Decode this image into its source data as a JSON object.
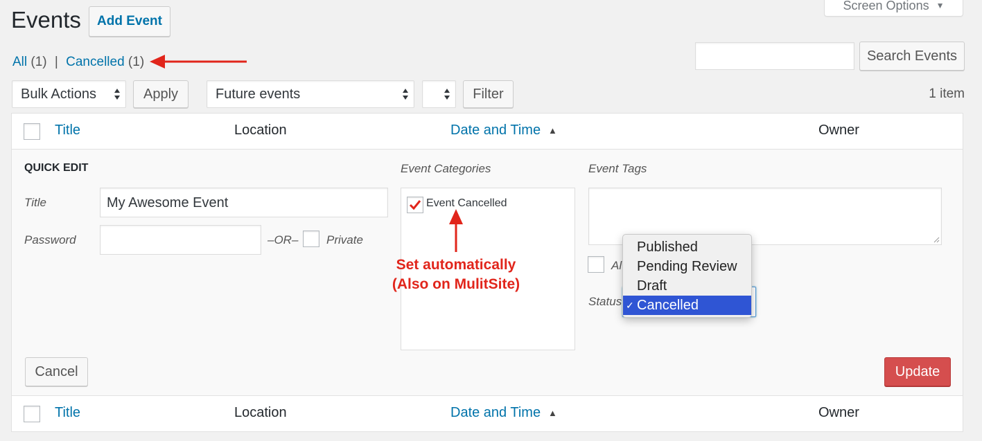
{
  "page": {
    "title": "Events",
    "add_button": "Add Event",
    "screen_options": "Screen Options"
  },
  "views": {
    "all_label": "All",
    "all_count": "(1)",
    "separator": "|",
    "cancelled_label": "Cancelled",
    "cancelled_count": "(1)"
  },
  "search": {
    "value": "",
    "button": "Search Events"
  },
  "toolbar": {
    "bulk_actions": "Bulk Actions",
    "apply": "Apply",
    "scope": "Future events",
    "category_select": "",
    "filter": "Filter",
    "item_count": "1 item"
  },
  "table": {
    "columns": [
      "Title",
      "Location",
      "Date and Time",
      "Owner"
    ]
  },
  "quick_edit": {
    "heading": "QUICK EDIT",
    "title_label": "Title",
    "title_value": "My Awesome Event",
    "password_label": "Password",
    "password_value": "",
    "or_label": "–OR–",
    "private_label": "Private",
    "categories_label": "Event Categories",
    "categories": [
      {
        "label": "Event Cancelled",
        "checked": true
      }
    ],
    "tags_label": "Event Tags",
    "tags_value": "",
    "allow_comments_label": "Al",
    "status_label": "Status",
    "status_options": [
      "Published",
      "Pending Review",
      "Draft",
      "Cancelled"
    ],
    "status_selected": "Cancelled",
    "cancel": "Cancel",
    "update": "Update"
  },
  "annotation": {
    "line1": "Set automatically",
    "line2": "(Also on MulitSite)"
  },
  "colors": {
    "link": "#0073aa",
    "update_button": "#d54e4e",
    "annotation_red": "#e1251b",
    "dropdown_selected": "#2f55d4"
  },
  "icons": [
    "chevron-down-icon",
    "updown-arrow-icon",
    "sort-up-icon",
    "checkmark-icon",
    "red-arrow-icon"
  ]
}
